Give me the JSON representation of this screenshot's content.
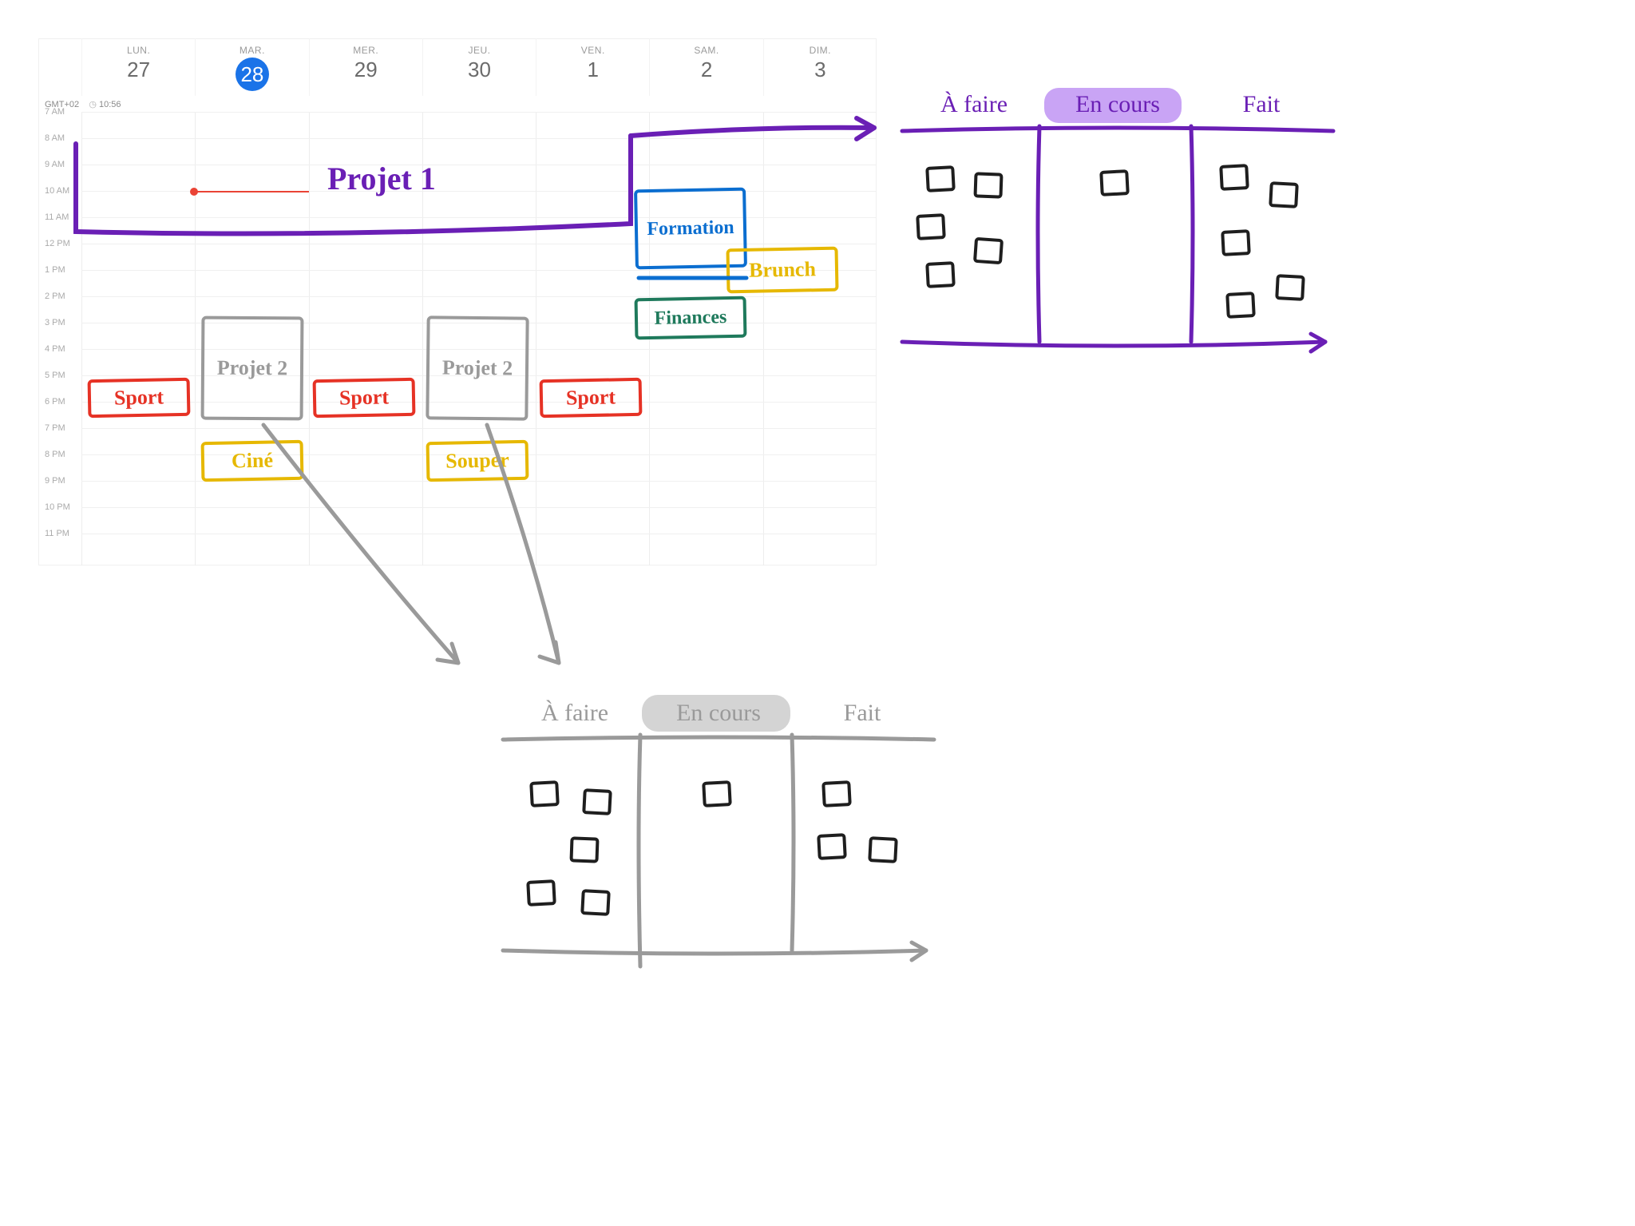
{
  "calendar": {
    "timezone": "GMT+02",
    "time_display": "10:56",
    "days": [
      {
        "dow": "LUN.",
        "num": "27",
        "today": false
      },
      {
        "dow": "MAR.",
        "num": "28",
        "today": true
      },
      {
        "dow": "MER.",
        "num": "29",
        "today": false
      },
      {
        "dow": "JEU.",
        "num": "30",
        "today": false
      },
      {
        "dow": "VEN.",
        "num": "1",
        "today": false
      },
      {
        "dow": "SAM.",
        "num": "2",
        "today": false
      },
      {
        "dow": "DIM.",
        "num": "3",
        "today": false
      }
    ],
    "hours": [
      "7 AM",
      "8 AM",
      "9 AM",
      "10 AM",
      "11 AM",
      "12 PM",
      "1 PM",
      "2 PM",
      "3 PM",
      "4 PM",
      "5 PM",
      "6 PM",
      "7 PM",
      "8 PM",
      "9 PM",
      "10 PM",
      "11 PM"
    ]
  },
  "annotations": {
    "projet1": "Projet 1",
    "sport": "Sport",
    "projet2": "Projet 2",
    "cine": "Ciné",
    "souper": "Souper",
    "formation": "Formation",
    "brunch": "Brunch",
    "finances": "Finances"
  },
  "kanban": {
    "col_a": "À faire",
    "col_b": "En cours",
    "col_c": "Fait"
  },
  "colors": {
    "purple": "#6a1fb5",
    "red": "#e63225",
    "gray": "#9a9a9a",
    "yellow": "#e6b800",
    "blue": "#0b6ed0",
    "green": "#1f7a5c",
    "black": "#1e1e1e",
    "highlight_purple": "#c9a4f5",
    "highlight_gray": "#d4d4d4"
  }
}
